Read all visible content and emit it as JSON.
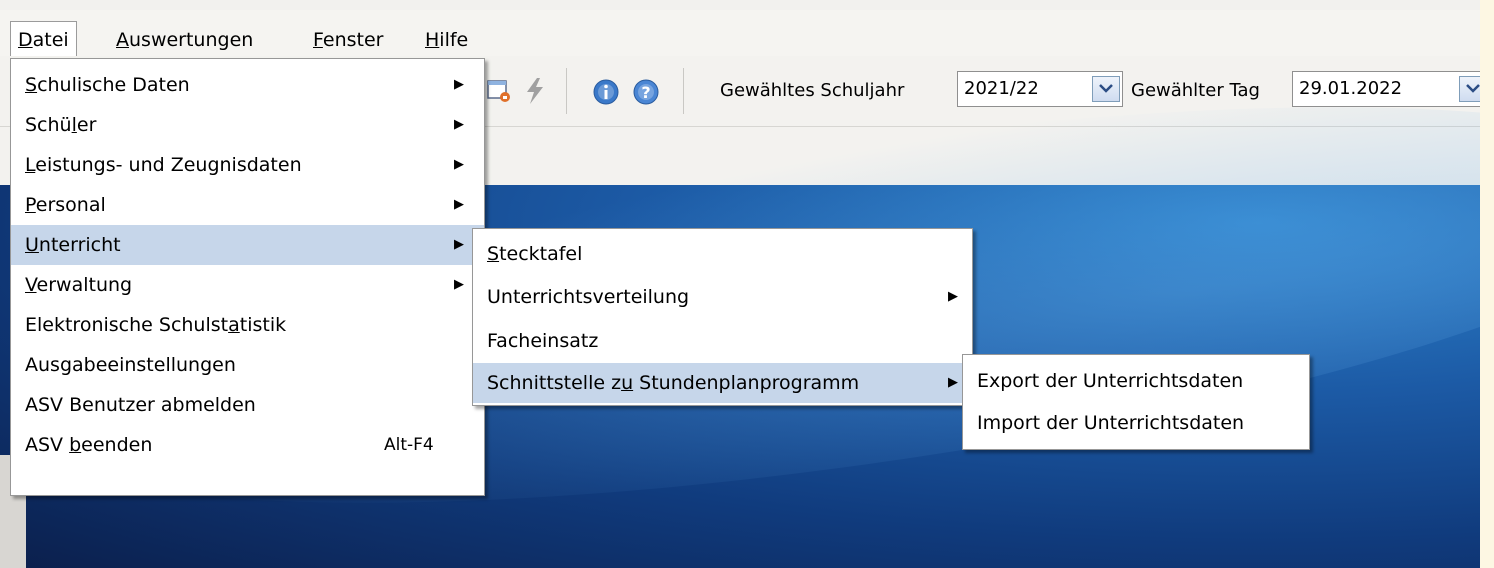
{
  "menubar": {
    "items": [
      {
        "label": "Datei",
        "mnemonic": "D",
        "rest": "atei"
      },
      {
        "label": "Auswertungen",
        "mnemonic": "A",
        "rest": "uswertungen"
      },
      {
        "label": "Fenster",
        "mnemonic": "F",
        "rest": "enster"
      },
      {
        "label": "Hilfe",
        "mnemonic": "H",
        "rest": "ilfe"
      }
    ]
  },
  "toolbar": {
    "schuljahr_label": "Gewähltes Schuljahr",
    "schuljahr_value": "2021/22",
    "tag_label": "Gewählter Tag",
    "tag_value": "29.01.2022",
    "icons": [
      "document-lock-icon",
      "lightning-icon",
      "info-icon",
      "help-icon"
    ]
  },
  "datei_menu": {
    "items": [
      {
        "pre": "",
        "ul": "S",
        "post": "chulische Daten",
        "submenu": true
      },
      {
        "pre": "Schü",
        "ul": "l",
        "post": "er",
        "submenu": true
      },
      {
        "pre": "",
        "ul": "L",
        "post": "eistungs- und Zeugnisdaten",
        "submenu": true
      },
      {
        "pre": "",
        "ul": "P",
        "post": "ersonal",
        "submenu": true
      },
      {
        "pre": "",
        "ul": "U",
        "post": "nterricht",
        "submenu": true
      },
      {
        "pre": "",
        "ul": "V",
        "post": "erwaltung",
        "submenu": true
      },
      {
        "pre": "Elektronische Schulst",
        "ul": "a",
        "post": "tistik",
        "submenu": false
      },
      {
        "pre": "Ausgabeeinstellungen",
        "ul": "",
        "post": "",
        "submenu": false
      },
      {
        "pre": "ASV Benutzer abmelden",
        "ul": "",
        "post": "",
        "submenu": false
      },
      {
        "pre": "ASV ",
        "ul": "b",
        "post": "eenden",
        "submenu": false,
        "accelerator": "Alt-F4"
      }
    ]
  },
  "unterricht_menu": {
    "items": [
      {
        "pre": "",
        "ul": "S",
        "post": "tecktafel",
        "submenu": false
      },
      {
        "pre": "Unterrichtsverteilung",
        "ul": "",
        "post": "",
        "submenu": true
      },
      {
        "pre": "Facheinsatz",
        "ul": "",
        "post": "",
        "submenu": false
      },
      {
        "pre": "Schnittstelle z",
        "ul": "u",
        "post": " Stundenplanprogramm",
        "submenu": true
      }
    ]
  },
  "schnittstelle_menu": {
    "items": [
      {
        "label": "Export der Unterrichtsdaten"
      },
      {
        "label": "Import der Unterrichtsdaten"
      }
    ]
  },
  "colors": {
    "menu_highlight": "#c6d6ea",
    "desktop": "#1c5aa5",
    "frame": "#fdf7e3"
  }
}
